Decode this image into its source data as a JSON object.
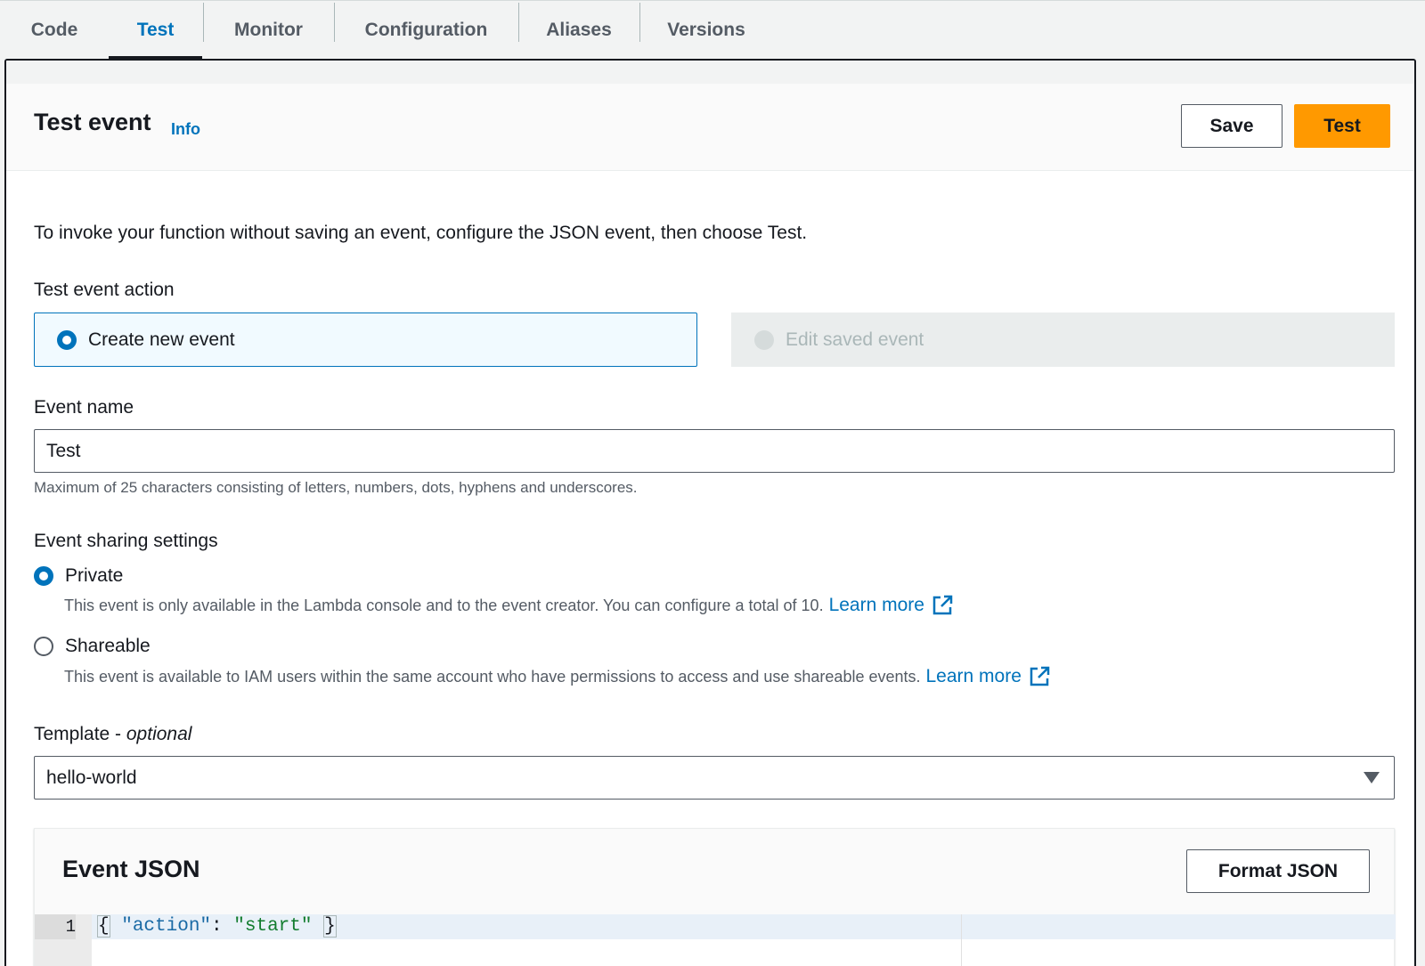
{
  "tabs": [
    {
      "label": "Code"
    },
    {
      "label": "Test"
    },
    {
      "label": "Monitor"
    },
    {
      "label": "Configuration"
    },
    {
      "label": "Aliases"
    },
    {
      "label": "Versions"
    }
  ],
  "active_tab": "Test",
  "header": {
    "title": "Test event",
    "info_label": "Info",
    "save_label": "Save",
    "test_label": "Test"
  },
  "description": "To invoke your function without saving an event, configure the JSON event, then choose Test.",
  "test_event_action": {
    "label": "Test event action",
    "options": [
      {
        "label": "Create new event",
        "selected": true,
        "disabled": false
      },
      {
        "label": "Edit saved event",
        "selected": false,
        "disabled": true
      }
    ]
  },
  "event_name": {
    "label": "Event name",
    "value": "Test",
    "hint": "Maximum of 25 characters consisting of letters, numbers, dots, hyphens and underscores."
  },
  "sharing": {
    "label": "Event sharing settings",
    "options": [
      {
        "label": "Private",
        "selected": true,
        "description": "This event is only available in the Lambda console and to the event creator. You can configure a total of 10.",
        "learn_more": "Learn more"
      },
      {
        "label": "Shareable",
        "selected": false,
        "description": "This event is available to IAM users within the same account who have permissions to access and use shareable events.",
        "learn_more": "Learn more"
      }
    ]
  },
  "template": {
    "label": "Template - ",
    "label_optional": "optional",
    "value": "hello-world"
  },
  "event_json": {
    "title": "Event JSON",
    "format_label": "Format JSON",
    "line_number": "1",
    "code": {
      "open": "{",
      "key": "\"action\"",
      "colon": ": ",
      "value": "\"start\"",
      "close": "}"
    }
  },
  "colors": {
    "accent": "#0073bb",
    "primary_button": "#ff9900",
    "text": "#16191f",
    "muted": "#545b64"
  }
}
